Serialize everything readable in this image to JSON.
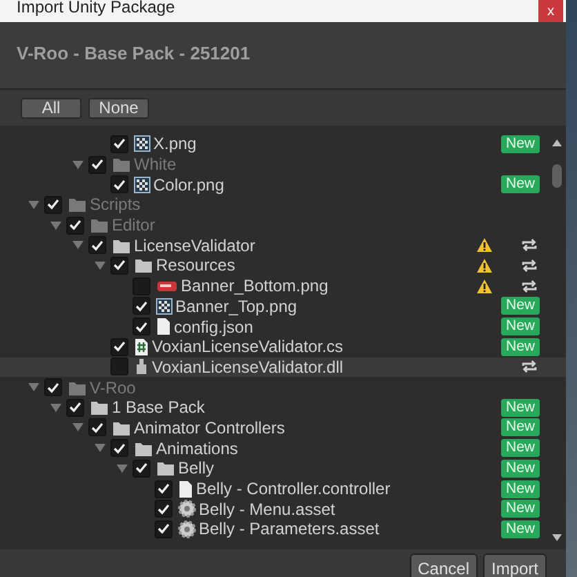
{
  "window": {
    "title": "Import Unity Package",
    "close": "x"
  },
  "package_title": "V-Roo - Base Pack - 251201",
  "select_buttons": [
    "All",
    "None"
  ],
  "tree": [
    {
      "children": [
        {
          "children": [
            {
              "children": [
                {
                  "children": [
                    {
                      "name": "X.png",
                      "kind": "image",
                      "checked": true,
                      "dimmed": false,
                      "selected": false,
                      "warning": false,
                      "reimport": false,
                      "badge": "New"
                    }
                  ]
                },
                {
                  "name": "White",
                  "kind": "folder",
                  "expanded": true,
                  "checked": true,
                  "dimmed": true,
                  "selected": false,
                  "warning": false,
                  "reimport": false,
                  "children": [
                    {
                      "name": "Color.png",
                      "kind": "image",
                      "checked": true,
                      "dimmed": false,
                      "selected": false,
                      "warning": false,
                      "reimport": false,
                      "badge": "New"
                    }
                  ]
                }
              ]
            }
          ]
        },
        {
          "name": "Scripts",
          "kind": "folder",
          "expanded": true,
          "checked": true,
          "dimmed": true,
          "selected": false,
          "warning": false,
          "reimport": false,
          "children": [
            {
              "name": "Editor",
              "kind": "folder",
              "expanded": true,
              "checked": true,
              "dimmed": true,
              "selected": false,
              "warning": false,
              "reimport": false,
              "children": [
                {
                  "name": "LicenseValidator",
                  "kind": "folder",
                  "expanded": true,
                  "checked": true,
                  "dimmed": false,
                  "selected": false,
                  "warning": true,
                  "reimport": true,
                  "children": [
                    {
                      "name": "Resources",
                      "kind": "folder",
                      "expanded": true,
                      "checked": true,
                      "dimmed": false,
                      "selected": false,
                      "warning": true,
                      "reimport": true,
                      "children": [
                        {
                          "name": "Banner_Bottom.png",
                          "kind": "sprite",
                          "checked": false,
                          "dimmed": false,
                          "selected": false,
                          "warning": true,
                          "reimport": true
                        },
                        {
                          "name": "Banner_Top.png",
                          "kind": "image",
                          "checked": true,
                          "dimmed": false,
                          "selected": false,
                          "warning": false,
                          "reimport": false,
                          "badge": "New"
                        },
                        {
                          "name": "config.json",
                          "kind": "file",
                          "checked": true,
                          "dimmed": false,
                          "selected": false,
                          "warning": false,
                          "reimport": false,
                          "badge": "New"
                        }
                      ]
                    },
                    {
                      "name": "VoxianLicenseValidator.cs",
                      "kind": "script",
                      "checked": true,
                      "dimmed": false,
                      "selected": false,
                      "warning": false,
                      "reimport": false,
                      "badge": "New"
                    },
                    {
                      "name": "VoxianLicenseValidator.dll",
                      "kind": "dll",
                      "checked": false,
                      "dimmed": false,
                      "selected": true,
                      "warning": false,
                      "reimport": true
                    }
                  ]
                }
              ]
            }
          ]
        },
        {
          "name": "V-Roo",
          "kind": "folder",
          "expanded": true,
          "checked": true,
          "dimmed": true,
          "selected": false,
          "warning": false,
          "reimport": false,
          "children": [
            {
              "name": "1 Base Pack",
              "kind": "folder",
              "expanded": true,
              "checked": true,
              "dimmed": false,
              "selected": false,
              "warning": false,
              "reimport": false,
              "badge": "New",
              "children": [
                {
                  "name": "Animator Controllers",
                  "kind": "folder",
                  "expanded": true,
                  "checked": true,
                  "dimmed": false,
                  "selected": false,
                  "warning": false,
                  "reimport": false,
                  "badge": "New",
                  "children": [
                    {
                      "name": "Animations",
                      "kind": "folder",
                      "expanded": true,
                      "checked": true,
                      "dimmed": false,
                      "selected": false,
                      "warning": false,
                      "reimport": false,
                      "badge": "New",
                      "children": [
                        {
                          "name": "Belly",
                          "kind": "folder",
                          "expanded": true,
                          "checked": true,
                          "dimmed": false,
                          "selected": false,
                          "warning": false,
                          "reimport": false,
                          "badge": "New",
                          "children": [
                            {
                              "name": "Belly - Controller.controller",
                              "kind": "file",
                              "checked": true,
                              "dimmed": false,
                              "selected": false,
                              "warning": false,
                              "reimport": false,
                              "badge": "New"
                            },
                            {
                              "name": "Belly - Menu.asset",
                              "kind": "asset",
                              "checked": true,
                              "dimmed": false,
                              "selected": false,
                              "warning": false,
                              "reimport": false,
                              "badge": "New"
                            },
                            {
                              "name": "Belly - Parameters.asset",
                              "kind": "asset",
                              "checked": true,
                              "dimmed": false,
                              "selected": false,
                              "warning": false,
                              "reimport": false,
                              "badge": "New"
                            }
                          ]
                        }
                      ]
                    }
                  ]
                }
              ]
            }
          ]
        }
      ]
    }
  ],
  "footer_buttons": [
    "Cancel",
    "Import"
  ]
}
